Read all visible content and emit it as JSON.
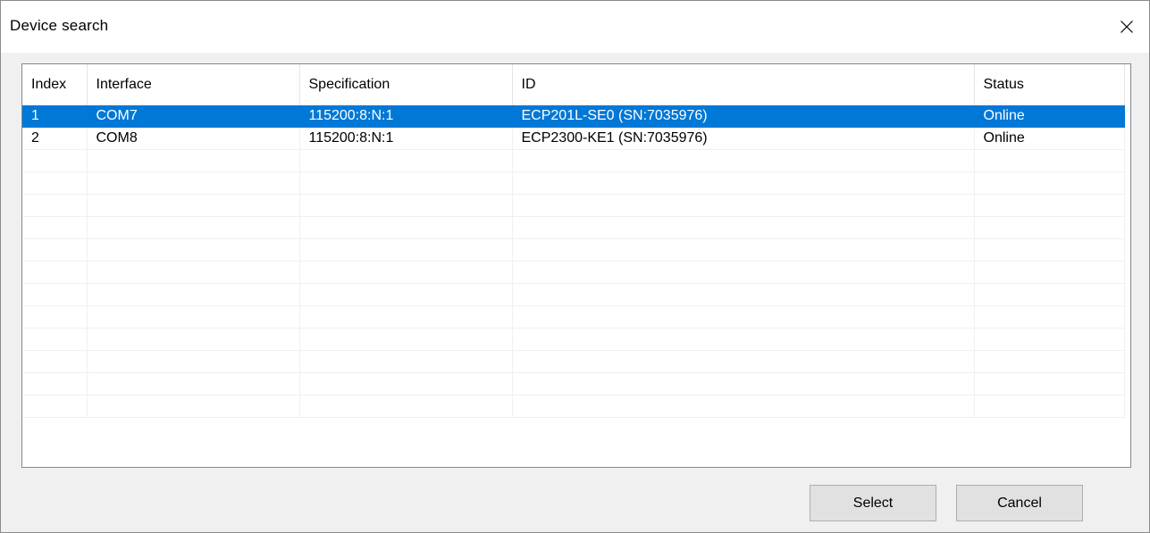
{
  "dialog": {
    "title": "Device search",
    "close_icon": "close-icon"
  },
  "table": {
    "columns": [
      "Index",
      "Interface",
      "Specification",
      "ID",
      "Status"
    ],
    "rows": [
      {
        "index": "1",
        "interface": "COM7",
        "specification": "115200:8:N:1",
        "id": "ECP201L-SE0 (SN:7035976)",
        "status": "Online",
        "selected": true
      },
      {
        "index": "2",
        "interface": "COM8",
        "specification": "115200:8:N:1",
        "id": "ECP2300-KE1 (SN:7035976)",
        "status": "Online",
        "selected": false
      }
    ],
    "empty_row_count": 12
  },
  "buttons": {
    "select_label": "Select",
    "cancel_label": "Cancel"
  },
  "colors": {
    "selection": "#0078d7",
    "dialog_bg": "#f0f0f0"
  }
}
